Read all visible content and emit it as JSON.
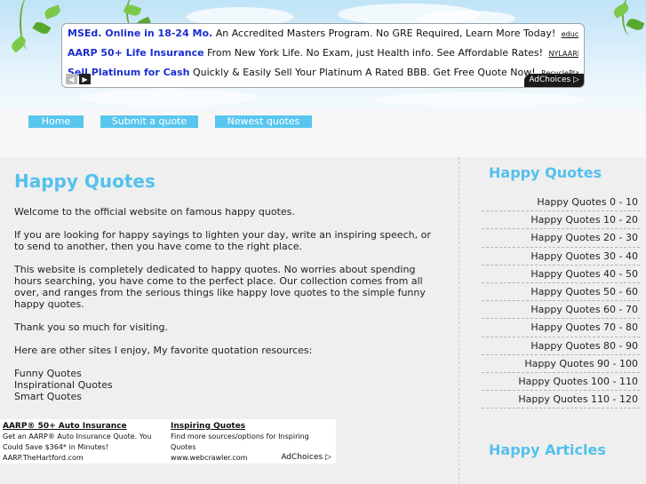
{
  "ads": [
    {
      "title": "MSEd. Online in 18-24 Mo.",
      "text": "An Accredited Masters Program. No GRE Required, Learn More Today!",
      "url": "education.une.edu"
    },
    {
      "title": "AARP 50+ Life Insurance",
      "text": "From New York Life. No Exam, just Health info. See Affordable Rates!",
      "url": "NYLAARP.com/Life-Insurance"
    },
    {
      "title": "Sell Platinum for Cash",
      "text": "Quickly & Easily Sell Your Platinum A Rated BBB. Get Free Quote Now!",
      "url": "RecyclePlatinum.com"
    }
  ],
  "adchoices": "AdChoices",
  "nav": {
    "home": "Home",
    "submit": "Submit a quote",
    "newest": "Newest quotes"
  },
  "main": {
    "title": "Happy Quotes",
    "paragraphs": [
      "Welcome to the official website on famous happy quotes.",
      "If you are looking for happy sayings to lighten your day, write an inspiring speech, or to send to another, then you have come to the right place.",
      "This website is completely dedicated to happy quotes. No worries about spending hours searching, you have come to the perfect place. Our collection comes from all over, and ranges from the serious things like happy love quotes to the simple funny happy quotes.",
      "Thank you so much for visiting.",
      "Here are other sites I enjoy, My favorite quotation resources:"
    ],
    "links": [
      "Funny Quotes",
      "Inspirational Quotes",
      "Smart Quotes"
    ]
  },
  "sidebar": {
    "title": "Happy Quotes",
    "items": [
      "Happy Quotes 0 - 10",
      "Happy Quotes 10 - 20",
      "Happy Quotes 20 - 30",
      "Happy Quotes 30 - 40",
      "Happy Quotes 40 - 50",
      "Happy Quotes 50 - 60",
      "Happy Quotes 60 - 70",
      "Happy Quotes 70 - 80",
      "Happy Quotes 80 - 90",
      "Happy Quotes 90 - 100",
      "Happy Quotes 100 - 110",
      "Happy Quotes 110 - 120"
    ],
    "title2": "Happy Articles"
  },
  "bottom_ads": [
    {
      "title": "AARP® 50+ Auto Insurance",
      "text": "Get an AARP® Auto Insurance Quote. You Could Save $364* in Minutes!",
      "url": "AARP.TheHartford.com"
    },
    {
      "title": "Inspiring Quotes",
      "text": "Find more sources/options for Inspiring Quotes",
      "url": "www.webcrawler.com"
    }
  ]
}
